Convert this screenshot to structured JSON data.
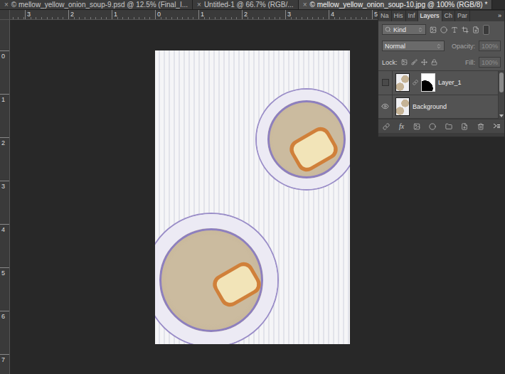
{
  "document_tabs": [
    {
      "close": "×",
      "label": "© mellow_yellow_onion_soup-9.psd @ 12.5% (Final_I...",
      "selected": false
    },
    {
      "close": "×",
      "label": "Untitled-1 @ 66.7% (RGB/...",
      "selected": false
    },
    {
      "close": "×",
      "label": "© mellow_yellow_onion_soup-10.jpg @ 100% (RGB/8) *",
      "selected": true
    }
  ],
  "ruler_top": [
    "3",
    "2",
    "1",
    "0",
    "1",
    "2",
    "3",
    "4",
    "5"
  ],
  "ruler_left": [
    "0",
    "1",
    "2",
    "3",
    "4",
    "5",
    "6",
    "7"
  ],
  "layers_panel": {
    "tabs": [
      {
        "label": "Na",
        "selected": false
      },
      {
        "label": "His",
        "selected": false
      },
      {
        "label": "Inf",
        "selected": false
      },
      {
        "label": "Layers",
        "selected": true
      },
      {
        "label": "Ch",
        "selected": false
      },
      {
        "label": "Par",
        "selected": false
      }
    ],
    "overflow": "»",
    "filter": {
      "label": "Kind"
    },
    "blend_mode": "Normal",
    "opacity": {
      "label": "Opacity:",
      "value": "100%",
      "disabled": true
    },
    "lock_label": "Lock:",
    "fill": {
      "label": "Fill:",
      "value": "100%",
      "disabled": true
    },
    "layers": [
      {
        "name": "Layer_1",
        "visible": false,
        "has_mask": true,
        "selected": false
      },
      {
        "name": "Background",
        "visible": true,
        "has_mask": false,
        "selected": false
      }
    ],
    "effects_label": "fx"
  }
}
